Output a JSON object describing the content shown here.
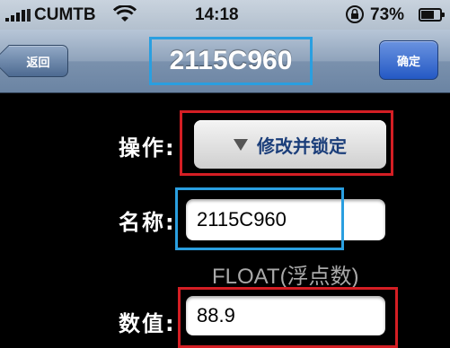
{
  "status_bar": {
    "carrier": "CUMTB",
    "time": "14:18",
    "battery_percent": "73%",
    "battery_level": 0.73,
    "icons": [
      "signal-bars-icon",
      "wifi-icon",
      "rotation-lock-icon",
      "battery-icon"
    ]
  },
  "nav": {
    "back_label": "返回",
    "title": "2115C960",
    "confirm_label": "确定"
  },
  "form": {
    "operation_label": "操作:",
    "operation_value": "修改并锁定",
    "name_label": "名称:",
    "name_value": "2115C960",
    "type_label": "FLOAT(浮点数)",
    "value_label": "数值:",
    "value_value": "88.9"
  },
  "colors": {
    "highlight_red": "#d41e24",
    "highlight_blue": "#2a9fe0",
    "nav_button_blue": "#2459c4"
  }
}
